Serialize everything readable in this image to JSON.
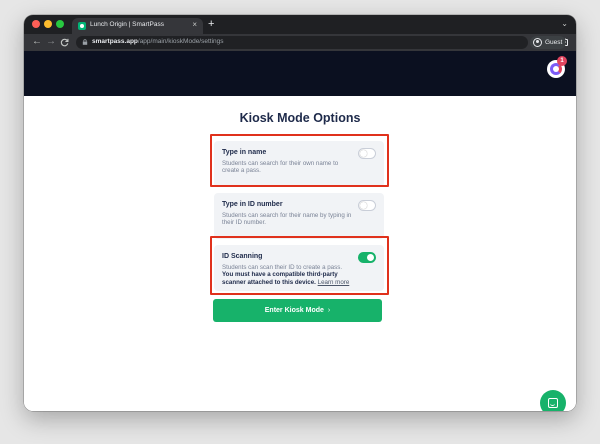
{
  "browser": {
    "tab": {
      "title": "Lunch Origin | SmartPass",
      "close_glyph": "×",
      "favicon": "smartpass-logo-icon"
    },
    "new_tab_glyph": "+",
    "tab_menu_glyph": "⌄",
    "nav": {
      "back": "←",
      "forward": "→",
      "reload": "C"
    },
    "url": {
      "host": "smartpass.app",
      "path": "/app/main/kioskMode/settings"
    },
    "profile_label": "Guest",
    "menu_glyph": "⋮"
  },
  "app": {
    "notification_count": "1",
    "brand_colors": {
      "primary": "#17b26a",
      "header": "#0b1020",
      "badge": "#e0445e",
      "highlight": "#e0311c"
    }
  },
  "page": {
    "title": "Kiosk Mode Options",
    "options": [
      {
        "title": "Type in name",
        "desc": "Students can search for their own name to create a pass.",
        "enabled": false
      },
      {
        "title": "Type in ID number",
        "desc": "Students can search for their name by typing in their ID number.",
        "enabled": false
      },
      {
        "title": "ID Scanning",
        "desc": "Students can scan their ID to create a pass.",
        "desc_bold": "You must have a compatible third-party scanner attached to this device.",
        "link": "Learn more",
        "enabled": true
      }
    ],
    "enter_button": "Enter Kiosk Mode",
    "enter_chevron": "›"
  }
}
